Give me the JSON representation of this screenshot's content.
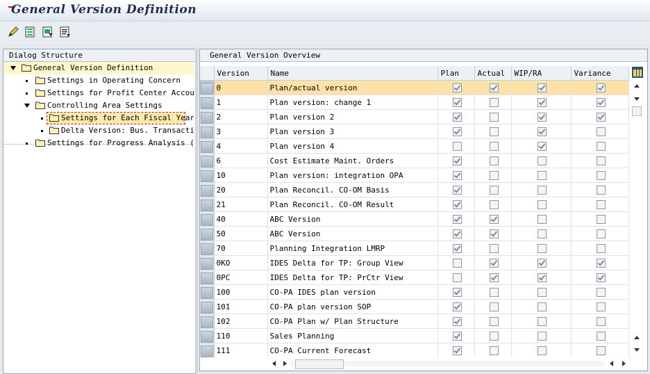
{
  "window": {
    "title": "General Version Definition"
  },
  "toolbar": {
    "buttons": [
      {
        "icon": "edit-pencil-icon"
      },
      {
        "icon": "choose-details-icon"
      },
      {
        "icon": "save-document-icon"
      },
      {
        "icon": "document-list-icon"
      }
    ]
  },
  "dialog": {
    "header": "Dialog Structure",
    "tree": [
      {
        "label": "General Version Definition",
        "level": 0,
        "expanded": true
      },
      {
        "label": "Settings in Operating Concern",
        "level": 1
      },
      {
        "label": "Settings for Profit Center Accounti",
        "level": 1
      },
      {
        "label": "Controlling Area Settings",
        "level": 1,
        "expanded": true
      },
      {
        "label": "Settings for Each Fiscal Year",
        "level": 2,
        "selected": true
      },
      {
        "label": "Delta Version: Bus. Transactions",
        "level": 2
      },
      {
        "label": "Settings for Progress Analysis (Pro",
        "level": 1
      }
    ]
  },
  "overview": {
    "header": "General Version Overview",
    "columns": [
      "Version",
      "Name",
      "Plan",
      "Actual",
      "WIP/RA",
      "Variance"
    ],
    "rows": [
      {
        "version": "0",
        "name": "Plan/actual version",
        "plan": true,
        "actual": true,
        "wip": true,
        "variance": true
      },
      {
        "version": "1",
        "name": "Plan version: change 1",
        "plan": true,
        "actual": false,
        "wip": true,
        "variance": true
      },
      {
        "version": "2",
        "name": "Plan version 2",
        "plan": true,
        "actual": false,
        "wip": true,
        "variance": true
      },
      {
        "version": "3",
        "name": "Plan version 3",
        "plan": true,
        "actual": false,
        "wip": true,
        "variance": false
      },
      {
        "version": "4",
        "name": "Plan version 4",
        "plan": false,
        "actual": false,
        "wip": true,
        "variance": false
      },
      {
        "version": "6",
        "name": "Cost Estimate Maint. Orders",
        "plan": true,
        "actual": false,
        "wip": false,
        "variance": false
      },
      {
        "version": "10",
        "name": "Plan version: integration OPA",
        "plan": true,
        "actual": false,
        "wip": false,
        "variance": false
      },
      {
        "version": "20",
        "name": "Plan Reconcil. CO-OM Basis",
        "plan": true,
        "actual": false,
        "wip": false,
        "variance": false
      },
      {
        "version": "21",
        "name": "Plan Reconcil. CO-OM Result",
        "plan": true,
        "actual": false,
        "wip": false,
        "variance": false
      },
      {
        "version": "40",
        "name": "ABC Version",
        "plan": true,
        "actual": true,
        "wip": false,
        "variance": false
      },
      {
        "version": "50",
        "name": "ABC Version",
        "plan": true,
        "actual": true,
        "wip": false,
        "variance": false
      },
      {
        "version": "70",
        "name": "Planning Integration LMRP",
        "plan": true,
        "actual": false,
        "wip": false,
        "variance": false
      },
      {
        "version": "0KO",
        "name": "IDES Delta for TP: Group View",
        "plan": false,
        "actual": true,
        "wip": true,
        "variance": true
      },
      {
        "version": "0PC",
        "name": "IDES Delta for TP: PrCtr View",
        "plan": false,
        "actual": true,
        "wip": true,
        "variance": true
      },
      {
        "version": "100",
        "name": "CO-PA IDES plan version",
        "plan": true,
        "actual": false,
        "wip": false,
        "variance": false
      },
      {
        "version": "101",
        "name": "CO-PA plan version SOP",
        "plan": true,
        "actual": false,
        "wip": false,
        "variance": false
      },
      {
        "version": "102",
        "name": "CO-PA Plan w/ Plan Structure",
        "plan": true,
        "actual": false,
        "wip": false,
        "variance": false
      },
      {
        "version": "110",
        "name": "Sales Planning",
        "plan": true,
        "actual": false,
        "wip": false,
        "variance": false
      },
      {
        "version": "111",
        "name": "CO-PA Current Forecast",
        "plan": true,
        "actual": false,
        "wip": false,
        "variance": false
      }
    ]
  }
}
